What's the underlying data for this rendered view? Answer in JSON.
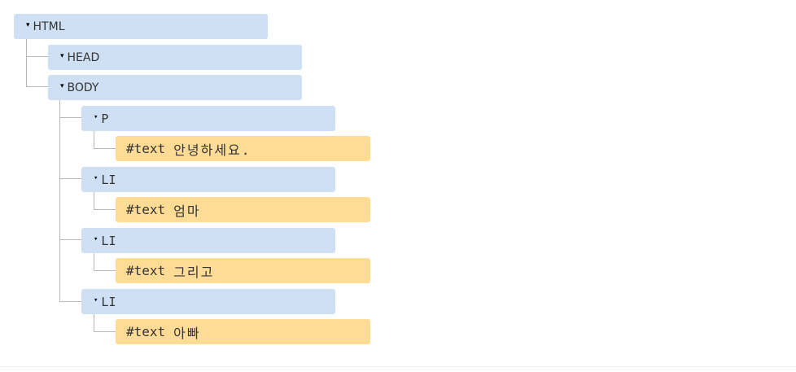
{
  "tree": {
    "expand_marker": "▾",
    "html": {
      "label": "HTML"
    },
    "head": {
      "label": "HEAD"
    },
    "body": {
      "label": "BODY"
    },
    "p": {
      "label": "P",
      "text_label": "#text",
      "text_value": "안녕하세요."
    },
    "li1": {
      "label": "LI",
      "text_label": "#text",
      "text_value": "엄마"
    },
    "li2": {
      "label": "LI",
      "text_label": "#text",
      "text_value": "그리고"
    },
    "li3": {
      "label": "LI",
      "text_label": "#text",
      "text_value": "아빠"
    }
  },
  "colors": {
    "element_node": "#cfe0f5",
    "text_node": "#ffdc96",
    "connector": "#b8b8b8"
  }
}
